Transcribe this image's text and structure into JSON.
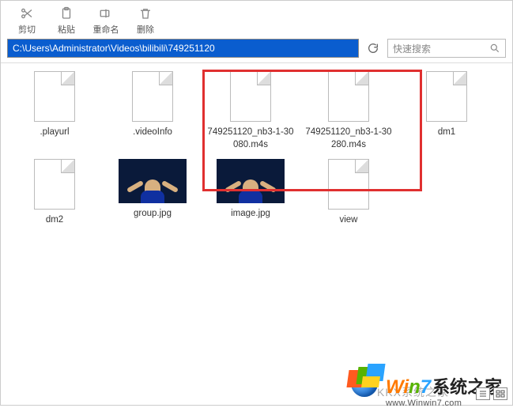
{
  "toolbar": {
    "cut": "剪切",
    "paste": "粘贴",
    "rename": "重命名",
    "delete": "删除"
  },
  "path": "C:\\Users\\Administrator\\Videos\\bilibili\\749251120",
  "search": {
    "placeholder": "快速搜索"
  },
  "files_row1": [
    {
      "name": ".playurl",
      "type": "doc"
    },
    {
      "name": ".videoInfo",
      "type": "doc"
    },
    {
      "name": "749251120_nb3-1-30080.m4s",
      "type": "doc"
    },
    {
      "name": "749251120_nb3-1-30280.m4s",
      "type": "doc"
    },
    {
      "name": "dm1",
      "type": "doc"
    }
  ],
  "files_row2": [
    {
      "name": "dm2",
      "type": "doc"
    },
    {
      "name": "group.jpg",
      "type": "img"
    },
    {
      "name": "image.jpg",
      "type": "img"
    },
    {
      "name": "view",
      "type": "doc"
    }
  ],
  "watermark": "KKX系统之家",
  "brand": {
    "wi": "Wi",
    "n": "n",
    "seven": "7",
    "zh": "系统之家",
    "sub": "www.Winwin7.com"
  }
}
